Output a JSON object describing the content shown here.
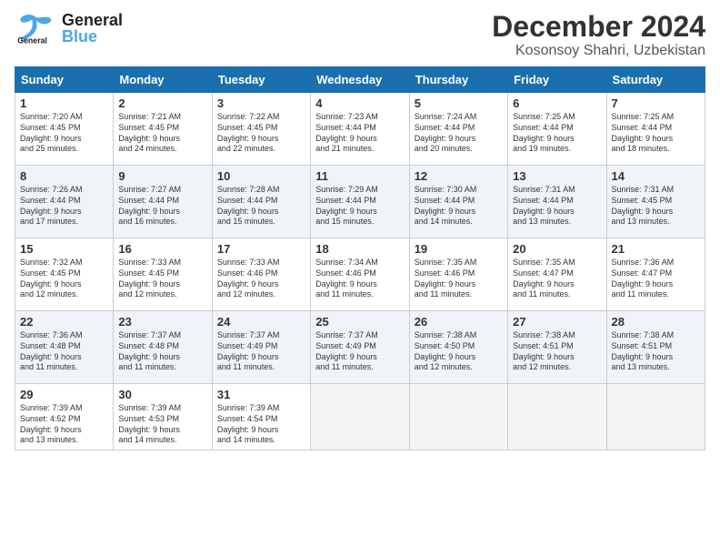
{
  "header": {
    "logo_general": "General",
    "logo_blue": "Blue",
    "month": "December 2024",
    "location": "Kosonsoy Shahri, Uzbekistan"
  },
  "days_of_week": [
    "Sunday",
    "Monday",
    "Tuesday",
    "Wednesday",
    "Thursday",
    "Friday",
    "Saturday"
  ],
  "weeks": [
    [
      {
        "day": "1",
        "lines": [
          "Sunrise: 7:20 AM",
          "Sunset: 4:45 PM",
          "Daylight: 9 hours",
          "and 25 minutes."
        ]
      },
      {
        "day": "2",
        "lines": [
          "Sunrise: 7:21 AM",
          "Sunset: 4:45 PM",
          "Daylight: 9 hours",
          "and 24 minutes."
        ]
      },
      {
        "day": "3",
        "lines": [
          "Sunrise: 7:22 AM",
          "Sunset: 4:45 PM",
          "Daylight: 9 hours",
          "and 22 minutes."
        ]
      },
      {
        "day": "4",
        "lines": [
          "Sunrise: 7:23 AM",
          "Sunset: 4:44 PM",
          "Daylight: 9 hours",
          "and 21 minutes."
        ]
      },
      {
        "day": "5",
        "lines": [
          "Sunrise: 7:24 AM",
          "Sunset: 4:44 PM",
          "Daylight: 9 hours",
          "and 20 minutes."
        ]
      },
      {
        "day": "6",
        "lines": [
          "Sunrise: 7:25 AM",
          "Sunset: 4:44 PM",
          "Daylight: 9 hours",
          "and 19 minutes."
        ]
      },
      {
        "day": "7",
        "lines": [
          "Sunrise: 7:25 AM",
          "Sunset: 4:44 PM",
          "Daylight: 9 hours",
          "and 18 minutes."
        ]
      }
    ],
    [
      {
        "day": "8",
        "lines": [
          "Sunrise: 7:26 AM",
          "Sunset: 4:44 PM",
          "Daylight: 9 hours",
          "and 17 minutes."
        ]
      },
      {
        "day": "9",
        "lines": [
          "Sunrise: 7:27 AM",
          "Sunset: 4:44 PM",
          "Daylight: 9 hours",
          "and 16 minutes."
        ]
      },
      {
        "day": "10",
        "lines": [
          "Sunrise: 7:28 AM",
          "Sunset: 4:44 PM",
          "Daylight: 9 hours",
          "and 15 minutes."
        ]
      },
      {
        "day": "11",
        "lines": [
          "Sunrise: 7:29 AM",
          "Sunset: 4:44 PM",
          "Daylight: 9 hours",
          "and 15 minutes."
        ]
      },
      {
        "day": "12",
        "lines": [
          "Sunrise: 7:30 AM",
          "Sunset: 4:44 PM",
          "Daylight: 9 hours",
          "and 14 minutes."
        ]
      },
      {
        "day": "13",
        "lines": [
          "Sunrise: 7:31 AM",
          "Sunset: 4:44 PM",
          "Daylight: 9 hours",
          "and 13 minutes."
        ]
      },
      {
        "day": "14",
        "lines": [
          "Sunrise: 7:31 AM",
          "Sunset: 4:45 PM",
          "Daylight: 9 hours",
          "and 13 minutes."
        ]
      }
    ],
    [
      {
        "day": "15",
        "lines": [
          "Sunrise: 7:32 AM",
          "Sunset: 4:45 PM",
          "Daylight: 9 hours",
          "and 12 minutes."
        ]
      },
      {
        "day": "16",
        "lines": [
          "Sunrise: 7:33 AM",
          "Sunset: 4:45 PM",
          "Daylight: 9 hours",
          "and 12 minutes."
        ]
      },
      {
        "day": "17",
        "lines": [
          "Sunrise: 7:33 AM",
          "Sunset: 4:46 PM",
          "Daylight: 9 hours",
          "and 12 minutes."
        ]
      },
      {
        "day": "18",
        "lines": [
          "Sunrise: 7:34 AM",
          "Sunset: 4:46 PM",
          "Daylight: 9 hours",
          "and 11 minutes."
        ]
      },
      {
        "day": "19",
        "lines": [
          "Sunrise: 7:35 AM",
          "Sunset: 4:46 PM",
          "Daylight: 9 hours",
          "and 11 minutes."
        ]
      },
      {
        "day": "20",
        "lines": [
          "Sunrise: 7:35 AM",
          "Sunset: 4:47 PM",
          "Daylight: 9 hours",
          "and 11 minutes."
        ]
      },
      {
        "day": "21",
        "lines": [
          "Sunrise: 7:36 AM",
          "Sunset: 4:47 PM",
          "Daylight: 9 hours",
          "and 11 minutes."
        ]
      }
    ],
    [
      {
        "day": "22",
        "lines": [
          "Sunrise: 7:36 AM",
          "Sunset: 4:48 PM",
          "Daylight: 9 hours",
          "and 11 minutes."
        ]
      },
      {
        "day": "23",
        "lines": [
          "Sunrise: 7:37 AM",
          "Sunset: 4:48 PM",
          "Daylight: 9 hours",
          "and 11 minutes."
        ]
      },
      {
        "day": "24",
        "lines": [
          "Sunrise: 7:37 AM",
          "Sunset: 4:49 PM",
          "Daylight: 9 hours",
          "and 11 minutes."
        ]
      },
      {
        "day": "25",
        "lines": [
          "Sunrise: 7:37 AM",
          "Sunset: 4:49 PM",
          "Daylight: 9 hours",
          "and 11 minutes."
        ]
      },
      {
        "day": "26",
        "lines": [
          "Sunrise: 7:38 AM",
          "Sunset: 4:50 PM",
          "Daylight: 9 hours",
          "and 12 minutes."
        ]
      },
      {
        "day": "27",
        "lines": [
          "Sunrise: 7:38 AM",
          "Sunset: 4:51 PM",
          "Daylight: 9 hours",
          "and 12 minutes."
        ]
      },
      {
        "day": "28",
        "lines": [
          "Sunrise: 7:38 AM",
          "Sunset: 4:51 PM",
          "Daylight: 9 hours",
          "and 13 minutes."
        ]
      }
    ],
    [
      {
        "day": "29",
        "lines": [
          "Sunrise: 7:39 AM",
          "Sunset: 4:52 PM",
          "Daylight: 9 hours",
          "and 13 minutes."
        ]
      },
      {
        "day": "30",
        "lines": [
          "Sunrise: 7:39 AM",
          "Sunset: 4:53 PM",
          "Daylight: 9 hours",
          "and 14 minutes."
        ]
      },
      {
        "day": "31",
        "lines": [
          "Sunrise: 7:39 AM",
          "Sunset: 4:54 PM",
          "Daylight: 9 hours",
          "and 14 minutes."
        ]
      },
      null,
      null,
      null,
      null
    ]
  ]
}
